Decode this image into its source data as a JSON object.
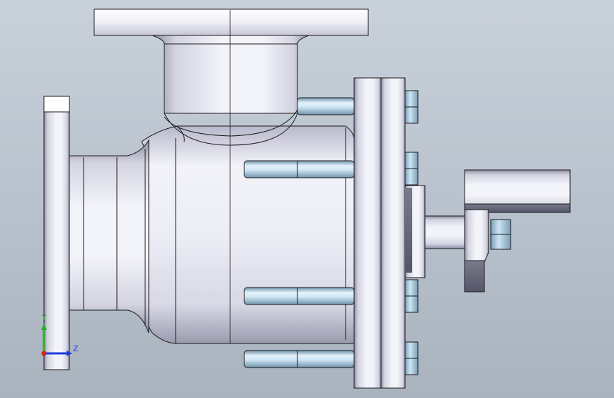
{
  "viewport": {
    "background": {
      "top": "#c9d1db",
      "bottom": "#a9b3be"
    }
  },
  "colors": {
    "body_light": "#f3f3fa",
    "body_mid": "#d4d4e2",
    "body_dark": "#8e8ea3",
    "edge": "#1a1a1a",
    "bolt_light": "#e4f2fb",
    "bolt_mid": "#a9cde3",
    "bolt_dark": "#6f93ab",
    "axis_y": "#2bb02b",
    "axis_z": "#1c3bd8",
    "origin": "#d42020"
  },
  "model": {
    "name": "ball-valve-assembly",
    "view": "side"
  },
  "triad": {
    "y_label": "Y",
    "z_label": "Z"
  }
}
